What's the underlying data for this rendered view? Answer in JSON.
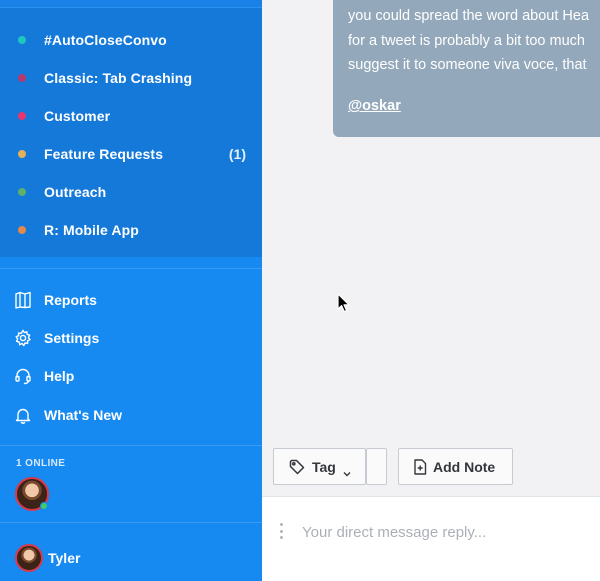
{
  "sidebar": {
    "tags": [
      {
        "label": "#AutoCloseConvo",
        "color": "#1dc7c0",
        "count": ""
      },
      {
        "label": "Classic: Tab Crashing",
        "color": "#b53a6c",
        "count": ""
      },
      {
        "label": "Customer",
        "color": "#e8356e",
        "count": ""
      },
      {
        "label": "Feature Requests",
        "color": "#e2b15c",
        "count": "(1)"
      },
      {
        "label": "Outreach",
        "color": "#5bb26a",
        "count": ""
      },
      {
        "label": "R: Mobile App",
        "color": "#e28a4c",
        "count": ""
      }
    ],
    "nav": [
      {
        "label": "Reports",
        "icon": "reports-icon"
      },
      {
        "label": "Settings",
        "icon": "gear-icon"
      },
      {
        "label": "Help",
        "icon": "headset-icon"
      },
      {
        "label": "What's New",
        "icon": "bell-icon"
      }
    ],
    "online_label": "1 ONLINE",
    "user_name": "Tyler"
  },
  "conversation": {
    "bubble_lines": [
      "you could spread the word about Hea",
      "for a tweet is probably a bit too much",
      "suggest it to someone viva voce, that"
    ],
    "mention": "@oskar"
  },
  "toolbar": {
    "tag_label": "Tag",
    "add_note_label": "Add Note"
  },
  "reply": {
    "placeholder": "Your direct message reply..."
  }
}
